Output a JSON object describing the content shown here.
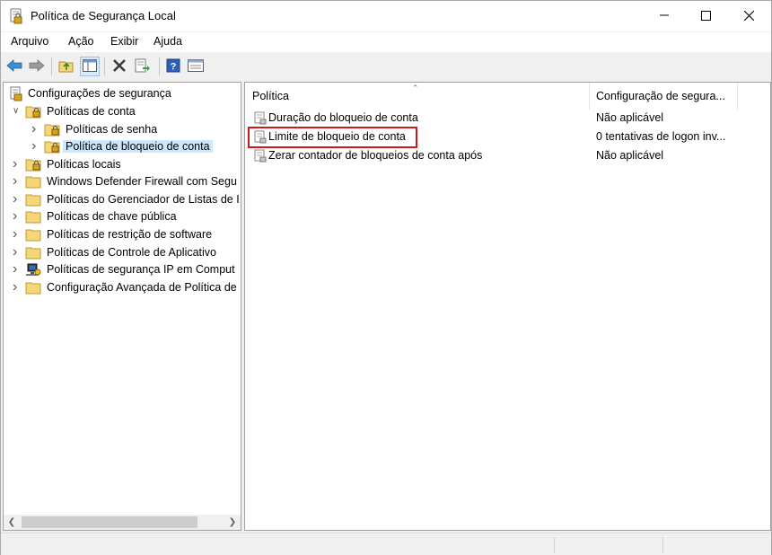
{
  "window": {
    "title": "Política de Segurança Local"
  },
  "menu": [
    "Arquivo",
    "Ação",
    "Exibir",
    "Ajuda"
  ],
  "toolbar": {
    "buttons": [
      "back-icon",
      "forward-icon",
      "up-folder-icon",
      "show-hide-tree-icon",
      "delete-icon",
      "export-list-icon",
      "help-icon",
      "properties-icon"
    ]
  },
  "tree": {
    "root": "Configurações de segurança",
    "items": [
      {
        "label": "Políticas de conta",
        "icon": "folder-lock-icon",
        "expanded": true
      },
      {
        "label": "Políticas de senha",
        "icon": "folder-lock-icon"
      },
      {
        "label": "Política de bloqueio de conta",
        "icon": "folder-lock-icon",
        "selected": true
      },
      {
        "label": "Políticas locais",
        "icon": "folder-lock-icon"
      },
      {
        "label": "Windows Defender Firewall com Segu",
        "icon": "folder-icon"
      },
      {
        "label": "Políticas do Gerenciador de Listas de I",
        "icon": "folder-icon"
      },
      {
        "label": "Políticas de chave pública",
        "icon": "folder-icon"
      },
      {
        "label": "Políticas de restrição de software",
        "icon": "folder-icon"
      },
      {
        "label": "Políticas de Controle de Aplicativo",
        "icon": "folder-icon"
      },
      {
        "label": "Políticas de segurança IP em Comput",
        "icon": "ip-security-icon"
      },
      {
        "label": "Configuração Avançada de Política de",
        "icon": "folder-icon"
      }
    ]
  },
  "list": {
    "columns": [
      "Política",
      "Configuração de segura..."
    ],
    "rows": [
      {
        "name": "Duração do bloqueio de conta",
        "value": "Não aplicável"
      },
      {
        "name": "Limite de bloqueio de conta",
        "value": "0 tentativas de logon inv...",
        "highlighted": true
      },
      {
        "name": "Zerar contador de bloqueios de conta após",
        "value": "Não aplicável"
      }
    ]
  },
  "colors": {
    "selection": "#cce8ff",
    "highlight_border": "#d0181f",
    "folder": "#f5d77a"
  }
}
